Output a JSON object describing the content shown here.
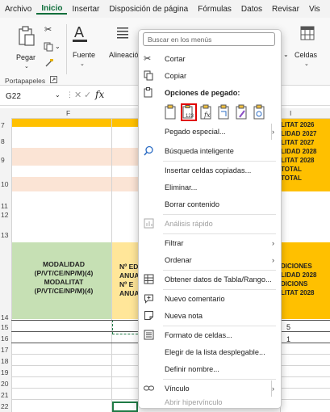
{
  "menubar": {
    "tabs": [
      "Archivo",
      "Inicio",
      "Insertar",
      "Disposición de página",
      "Fórmulas",
      "Datos",
      "Revisar",
      "Vis"
    ],
    "active_index": 1
  },
  "ribbon": {
    "paste_label": "Pegar",
    "font_label": "Fuente",
    "align_label": "Alineación",
    "cells_label": "Celdas",
    "clipboard_group": "Portapapeles"
  },
  "formula_bar": {
    "cell_ref": "G22",
    "fx": "fx"
  },
  "columns": {
    "f": "F",
    "i": "I"
  },
  "rows": [
    "7",
    "8",
    "9",
    "10",
    "11",
    "12",
    "13",
    "14",
    "15",
    "16",
    "17",
    "18",
    "19",
    "20",
    "21",
    "22"
  ],
  "sheet": {
    "right_header_lines": [
      "LITAT 2026",
      "LIDAD 2027",
      "LITAT 2027",
      "LIDAD 2028",
      "LITAT 2028",
      "TOTAL",
      "TOTAL"
    ],
    "modalidad_lines": [
      "MODALIDAD",
      "(P/VT/CE/NP/M)(4)",
      "MODALITAT",
      "(P/VT/CE/NP/M)(4)"
    ],
    "anual_lines": [
      "Nº ED",
      "ANUAL",
      "Nº E",
      "ANUAL"
    ],
    "ediciones_lines": [
      "DICIONES",
      "LIDAD 2028",
      "DICIONS",
      "LITAT 2028"
    ],
    "val_15": "5",
    "val_16": "1"
  },
  "context_menu": {
    "search_placeholder": "Buscar en los menús",
    "cut": "Cortar",
    "copy": "Copiar",
    "paste_options": "Opciones de pegado:",
    "paste_special": "Pegado especial...",
    "smart_lookup": "Búsqueda inteligente",
    "insert_copied": "Insertar celdas copiadas...",
    "delete": "Eliminar...",
    "clear": "Borrar contenido",
    "quick_analysis": "Análisis rápido",
    "filter": "Filtrar",
    "sort": "Ordenar",
    "get_data": "Obtener datos de Tabla/Rango...",
    "new_comment": "Nuevo comentario",
    "new_note": "Nueva nota",
    "format_cells": "Formato de celdas...",
    "pick_list": "Elegir de la lista desplegable...",
    "define_name": "Definir nombre...",
    "link": "Vínculo",
    "open_link": "Abrir hipervínculo"
  },
  "colors": {
    "accent_green": "#0e6e3a",
    "header_yellow": "#ffc000",
    "modalidad_green": "#c6e0b4",
    "anual_yellow": "#ffe699",
    "pink": "#fbe4d5",
    "paste_highlight": "#e00000"
  }
}
